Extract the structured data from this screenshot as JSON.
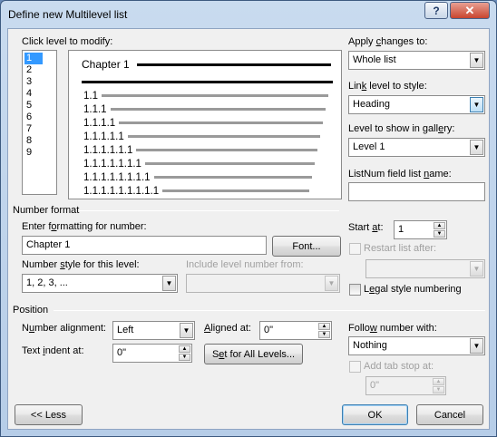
{
  "window": {
    "title": "Define new Multilevel list",
    "help_label": "?",
    "close_label": "✕"
  },
  "click_level": {
    "label": "Click level to modify:",
    "levels": [
      "1",
      "2",
      "3",
      "4",
      "5",
      "6",
      "7",
      "8",
      "9"
    ],
    "selected": "1"
  },
  "preview": {
    "chapter_text": "Chapter 1",
    "rows": [
      "1.1",
      "1.1.1",
      "1.1.1.1",
      "1.1.1.1.1",
      "1.1.1.1.1.1",
      "1.1.1.1.1.1.1",
      "1.1.1.1.1.1.1.1",
      "1.1.1.1.1.1.1.1.1"
    ]
  },
  "apply_changes": {
    "label": "Apply changes to:",
    "value": "Whole list"
  },
  "link_level": {
    "label": "Link level to style:",
    "value": "Heading"
  },
  "gallery_level": {
    "label": "Level to show in gallery:",
    "value": "Level 1"
  },
  "listnum": {
    "label": "ListNum field list name:",
    "value": ""
  },
  "number_format": {
    "group_label": "Number format",
    "enter_label": "Enter formatting for number:",
    "format_value": "Chapter 1",
    "font_button": "Font...",
    "style_label": "Number style for this level:",
    "style_value": "1, 2, 3, ...",
    "include_label": "Include level number from:",
    "include_value": ""
  },
  "start_at": {
    "label": "Start at:",
    "value": "1"
  },
  "restart": {
    "label": "Restart list after:",
    "value": ""
  },
  "legal": {
    "label": "Legal style numbering"
  },
  "position": {
    "group_label": "Position",
    "alignment_label": "Number alignment:",
    "alignment_value": "Left",
    "aligned_at_label": "Aligned at:",
    "aligned_at_value": "0\"",
    "indent_label": "Text indent at:",
    "indent_value": "0\"",
    "set_all_button": "Set for All Levels..."
  },
  "follow": {
    "label": "Follow number with:",
    "value": "Nothing"
  },
  "tab_stop": {
    "label": "Add tab stop at:",
    "value": "0\""
  },
  "buttons": {
    "less": "<< Less",
    "ok": "OK",
    "cancel": "Cancel"
  },
  "icons": {
    "dropdown": "chevron-down-icon",
    "spin_up": "arrow-up-icon",
    "spin_down": "arrow-down-icon"
  }
}
